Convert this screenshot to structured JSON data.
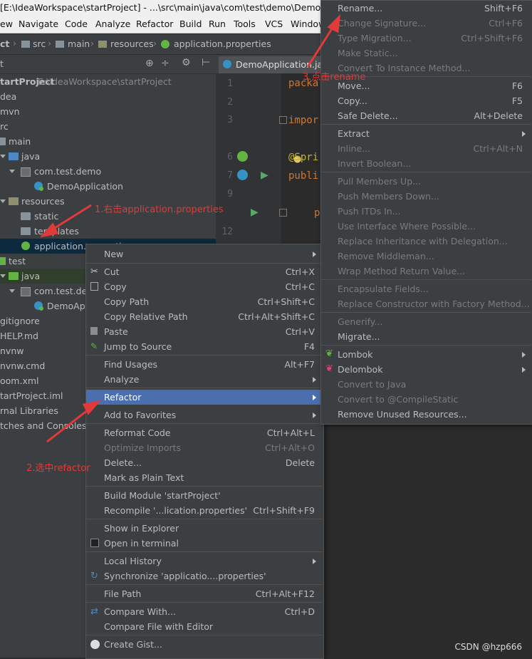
{
  "window": {
    "title": "[E:\\IdeaWorkspace\\startProject] - ...\\src\\main\\java\\com\\test\\demo\\DemoAp"
  },
  "menubar": {
    "items": [
      "ew",
      "Navigate",
      "Code",
      "Analyze",
      "Refactor",
      "Build",
      "Run",
      "Tools",
      "VCS",
      "Window"
    ]
  },
  "navbar": {
    "project": "ct",
    "crumbs": [
      "src",
      "main",
      "resources",
      "application.properties"
    ]
  },
  "tool_window": {
    "title": "t"
  },
  "tree": [
    {
      "label": "tartProject",
      "extra": "E:\\IdeaWorkspace\\startProject"
    },
    {
      "label": "dea"
    },
    {
      "label": "mvn"
    },
    {
      "label": "rc"
    },
    {
      "label": "main"
    },
    {
      "label": "java"
    },
    {
      "label": "com.test.demo"
    },
    {
      "label": "DemoApplication"
    },
    {
      "label": "resources"
    },
    {
      "label": "static"
    },
    {
      "label": "templates"
    },
    {
      "label": "application.properties"
    },
    {
      "label": "test"
    },
    {
      "label": "java"
    },
    {
      "label": "com.test.dem"
    },
    {
      "label": "DemoApp"
    },
    {
      "label": "gitignore"
    },
    {
      "label": "HELP.md"
    },
    {
      "label": "nvnw"
    },
    {
      "label": "nvnw.cmd"
    },
    {
      "label": "oom.xml"
    },
    {
      "label": "tartProject.iml"
    },
    {
      "label": "rnal Libraries"
    },
    {
      "label": "tches and Consoles"
    }
  ],
  "editor": {
    "tab": "DemoApplication.java",
    "line_numbers": [
      "1",
      "2",
      "3",
      "6",
      "7",
      "9",
      "12"
    ],
    "code": [
      "packa",
      "impor",
      "@Spri",
      "publi",
      "p"
    ]
  },
  "context_menu": [
    {
      "label": "New",
      "submenu": true
    },
    {
      "sep": true
    },
    {
      "label": "Cut",
      "shortcut": "Ctrl+X",
      "icon": "scissors-icon"
    },
    {
      "label": "Copy",
      "shortcut": "Ctrl+C",
      "icon": "copy-icon"
    },
    {
      "label": "Copy Path",
      "shortcut": "Ctrl+Shift+C"
    },
    {
      "label": "Copy Relative Path",
      "shortcut": "Ctrl+Alt+Shift+C"
    },
    {
      "label": "Paste",
      "shortcut": "Ctrl+V",
      "icon": "paste-icon"
    },
    {
      "label": "Jump to Source",
      "shortcut": "F4",
      "icon": "pencil-icon"
    },
    {
      "sep": true
    },
    {
      "label": "Find Usages",
      "shortcut": "Alt+F7"
    },
    {
      "label": "Analyze",
      "submenu": true
    },
    {
      "sep": true
    },
    {
      "label": "Refactor",
      "submenu": true,
      "selected": true
    },
    {
      "label": "Add to Favorites",
      "submenu": true
    },
    {
      "sep": true
    },
    {
      "label": "Reformat Code",
      "shortcut": "Ctrl+Alt+L"
    },
    {
      "label": "Optimize Imports",
      "shortcut": "Ctrl+Alt+O",
      "disabled": true
    },
    {
      "label": "Delete...",
      "shortcut": "Delete"
    },
    {
      "label": "Mark as Plain Text"
    },
    {
      "sep": true
    },
    {
      "label": "Build Module 'startProject'"
    },
    {
      "label": "Recompile '...lication.properties'",
      "shortcut": "Ctrl+Shift+F9"
    },
    {
      "sep": true
    },
    {
      "label": "Show in Explorer"
    },
    {
      "label": "Open in terminal",
      "icon": "terminal-icon"
    },
    {
      "sep": true
    },
    {
      "label": "Local History",
      "submenu": true
    },
    {
      "label": "Synchronize 'applicatio....properties'",
      "icon": "sync-icon"
    },
    {
      "sep": true
    },
    {
      "label": "File Path",
      "shortcut": "Ctrl+Alt+F12"
    },
    {
      "sep": true
    },
    {
      "label": "Compare With...",
      "shortcut": "Ctrl+D",
      "icon": "compare-icon"
    },
    {
      "label": "Compare File with Editor"
    },
    {
      "sep": true
    },
    {
      "label": "Create Gist...",
      "icon": "github-icon"
    }
  ],
  "refactor_menu": [
    {
      "label": "Rename...",
      "shortcut": "Shift+F6"
    },
    {
      "label": "Change Signature...",
      "shortcut": "Ctrl+F6",
      "disabled": true
    },
    {
      "label": "Type Migration...",
      "shortcut": "Ctrl+Shift+F6",
      "disabled": true
    },
    {
      "label": "Make Static...",
      "disabled": true
    },
    {
      "label": "Convert To Instance Method...",
      "disabled": true
    },
    {
      "sep": true
    },
    {
      "label": "Move...",
      "shortcut": "F6"
    },
    {
      "label": "Copy...",
      "shortcut": "F5"
    },
    {
      "label": "Safe Delete...",
      "shortcut": "Alt+Delete"
    },
    {
      "sep": true
    },
    {
      "label": "Extract",
      "submenu": true
    },
    {
      "label": "Inline...",
      "shortcut": "Ctrl+Alt+N",
      "disabled": true
    },
    {
      "label": "Invert Boolean...",
      "disabled": true
    },
    {
      "sep": true
    },
    {
      "label": "Pull Members Up...",
      "disabled": true
    },
    {
      "label": "Push Members Down...",
      "disabled": true
    },
    {
      "label": "Push ITDs In...",
      "disabled": true
    },
    {
      "label": "Use Interface Where Possible...",
      "disabled": true
    },
    {
      "label": "Replace Inheritance with Delegation...",
      "disabled": true
    },
    {
      "label": "Remove Middleman...",
      "disabled": true
    },
    {
      "label": "Wrap Method Return Value...",
      "disabled": true
    },
    {
      "sep": true
    },
    {
      "label": "Encapsulate Fields...",
      "disabled": true
    },
    {
      "label": "Replace Constructor with Factory Method...",
      "disabled": true
    },
    {
      "sep": true
    },
    {
      "label": "Generify...",
      "disabled": true
    },
    {
      "label": "Migrate..."
    },
    {
      "sep": true
    },
    {
      "label": "Lombok",
      "submenu": true,
      "icon": "lombok-icon"
    },
    {
      "label": "Delombok",
      "submenu": true,
      "icon": "delombok-icon"
    },
    {
      "label": "Convert to Java",
      "disabled": true
    },
    {
      "label": "Convert to @CompileStatic",
      "disabled": true
    },
    {
      "label": "Remove Unused Resources..."
    }
  ],
  "annotations": {
    "step1": "1.右击application.properties",
    "step2": "2.选中refactor",
    "step3": "3.点击rename"
  },
  "watermark": "CSDN @hzp666",
  "colors": {
    "selection": "#4b6eaf",
    "annotation": "#e03a3a",
    "panel": "#3c3f41",
    "editor_bg": "#2b2b2b"
  }
}
